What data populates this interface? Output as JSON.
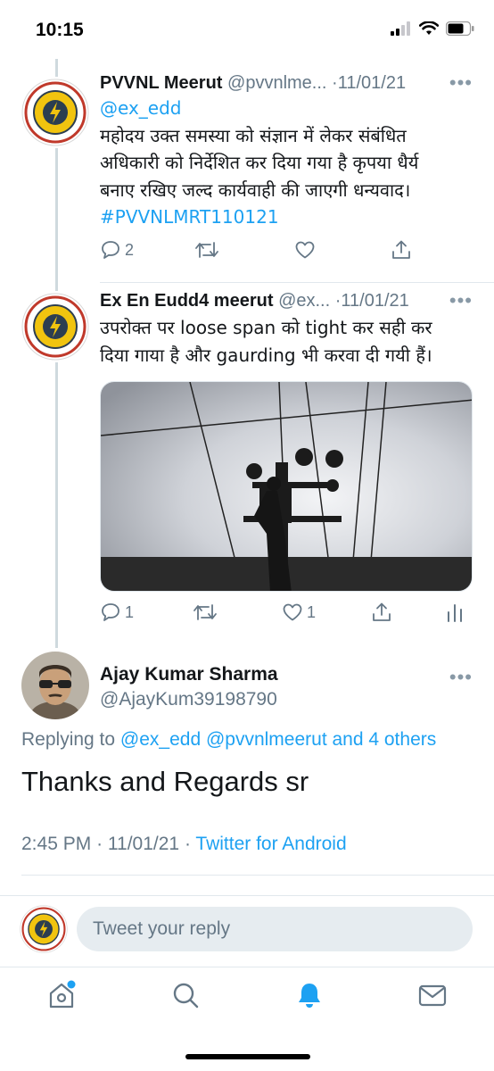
{
  "status_bar": {
    "time": "10:15"
  },
  "thread": [
    {
      "name": "PVVNL Meerut",
      "handle": "@pvvnlme...",
      "date": "11/01/21",
      "mention": "@ex_edd",
      "text_lines": [
        " महोदय उक्त समस्या को संज्ञान में लेकर संबंधित",
        "अधिकारी को निर्देशित कर दिया गया है कृपया धैर्य",
        "बनाए रखिए जल्द कार्यवाही की जाएगी धन्यवाद।"
      ],
      "hashtag": "#PVVNLMRT110121",
      "reply_count": "2",
      "like_count": ""
    },
    {
      "name": "Ex En Eudd4 meerut",
      "handle": "@ex...",
      "date": "11/01/21",
      "text_lines": [
        "उपरोक्त पर loose span को tight कर सही कर",
        "दिया गाया है और gaurding भी करवा दी गयी हैं।"
      ],
      "reply_count": "1",
      "like_count": "1"
    }
  ],
  "main_tweet": {
    "name": "Ajay Kumar Sharma",
    "handle": "@AjayKum39198790",
    "replying_prefix": "Replying to",
    "replying_targets": "@ex_edd @pvvnlmeerut and 4 others",
    "text": "Thanks and Regards sr",
    "time": "2:45 PM",
    "date": "11/01/21",
    "source": "Twitter for Android"
  },
  "compose": {
    "placeholder": "Tweet your reply"
  },
  "tabs": [
    "home-icon",
    "search-icon",
    "notifications-icon",
    "messages-icon"
  ],
  "colors": {
    "accent": "#1da1f2",
    "secondary_text": "#657786",
    "primary_text": "#14171a",
    "input_bg": "#e6ecf0"
  }
}
